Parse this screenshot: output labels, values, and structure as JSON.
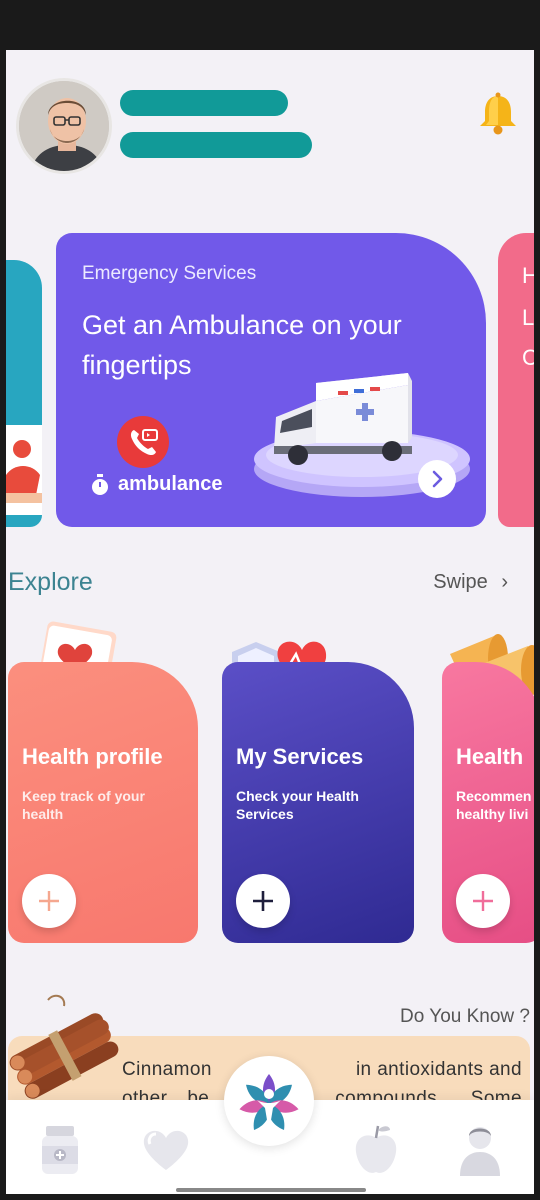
{
  "header": {
    "avatar_icon": "user-avatar",
    "notification_icon": "bell-icon"
  },
  "emergency_card": {
    "subtitle": "Emergency Services",
    "title": "Get an Ambulance on your fingertips",
    "action_label": "ambulance",
    "call_icon": "phone-call-icon",
    "timer_icon": "stopwatch-icon",
    "arrow_icon": "chevron-right-icon"
  },
  "side_cards": {
    "right_partial_chars": [
      "H",
      "L",
      "C"
    ]
  },
  "explore": {
    "title": "Explore",
    "swipe_label": "Swipe",
    "cards": [
      {
        "title": "Health profile",
        "description": "Keep track of your health",
        "color": "#f8786e",
        "plus_color": "#f5a78f"
      },
      {
        "title": "My Services",
        "description": "Check your Health Services",
        "color": "#3a3399",
        "plus_color": "#1e1e3c"
      },
      {
        "title": "Health",
        "description": "Recommen healthy livi",
        "color": "#e95a8c",
        "plus_color": "#f06d9a"
      }
    ]
  },
  "do_you_know": {
    "title": "Do You Know ?",
    "line1_a": "Cinnamon",
    "line1_b": "in antioxidants and",
    "line2_a": "other",
    "line2_b": "be",
    "line2_c": "compounds.",
    "line2_d": "Some"
  },
  "bottom_nav": {
    "items": [
      "medicine-icon",
      "heart-icon",
      "app-logo",
      "apple-icon",
      "profile-icon"
    ]
  },
  "colors": {
    "accent_teal": "#119a98",
    "card_purple": "#7159e9",
    "background": "#f3f1f6"
  }
}
